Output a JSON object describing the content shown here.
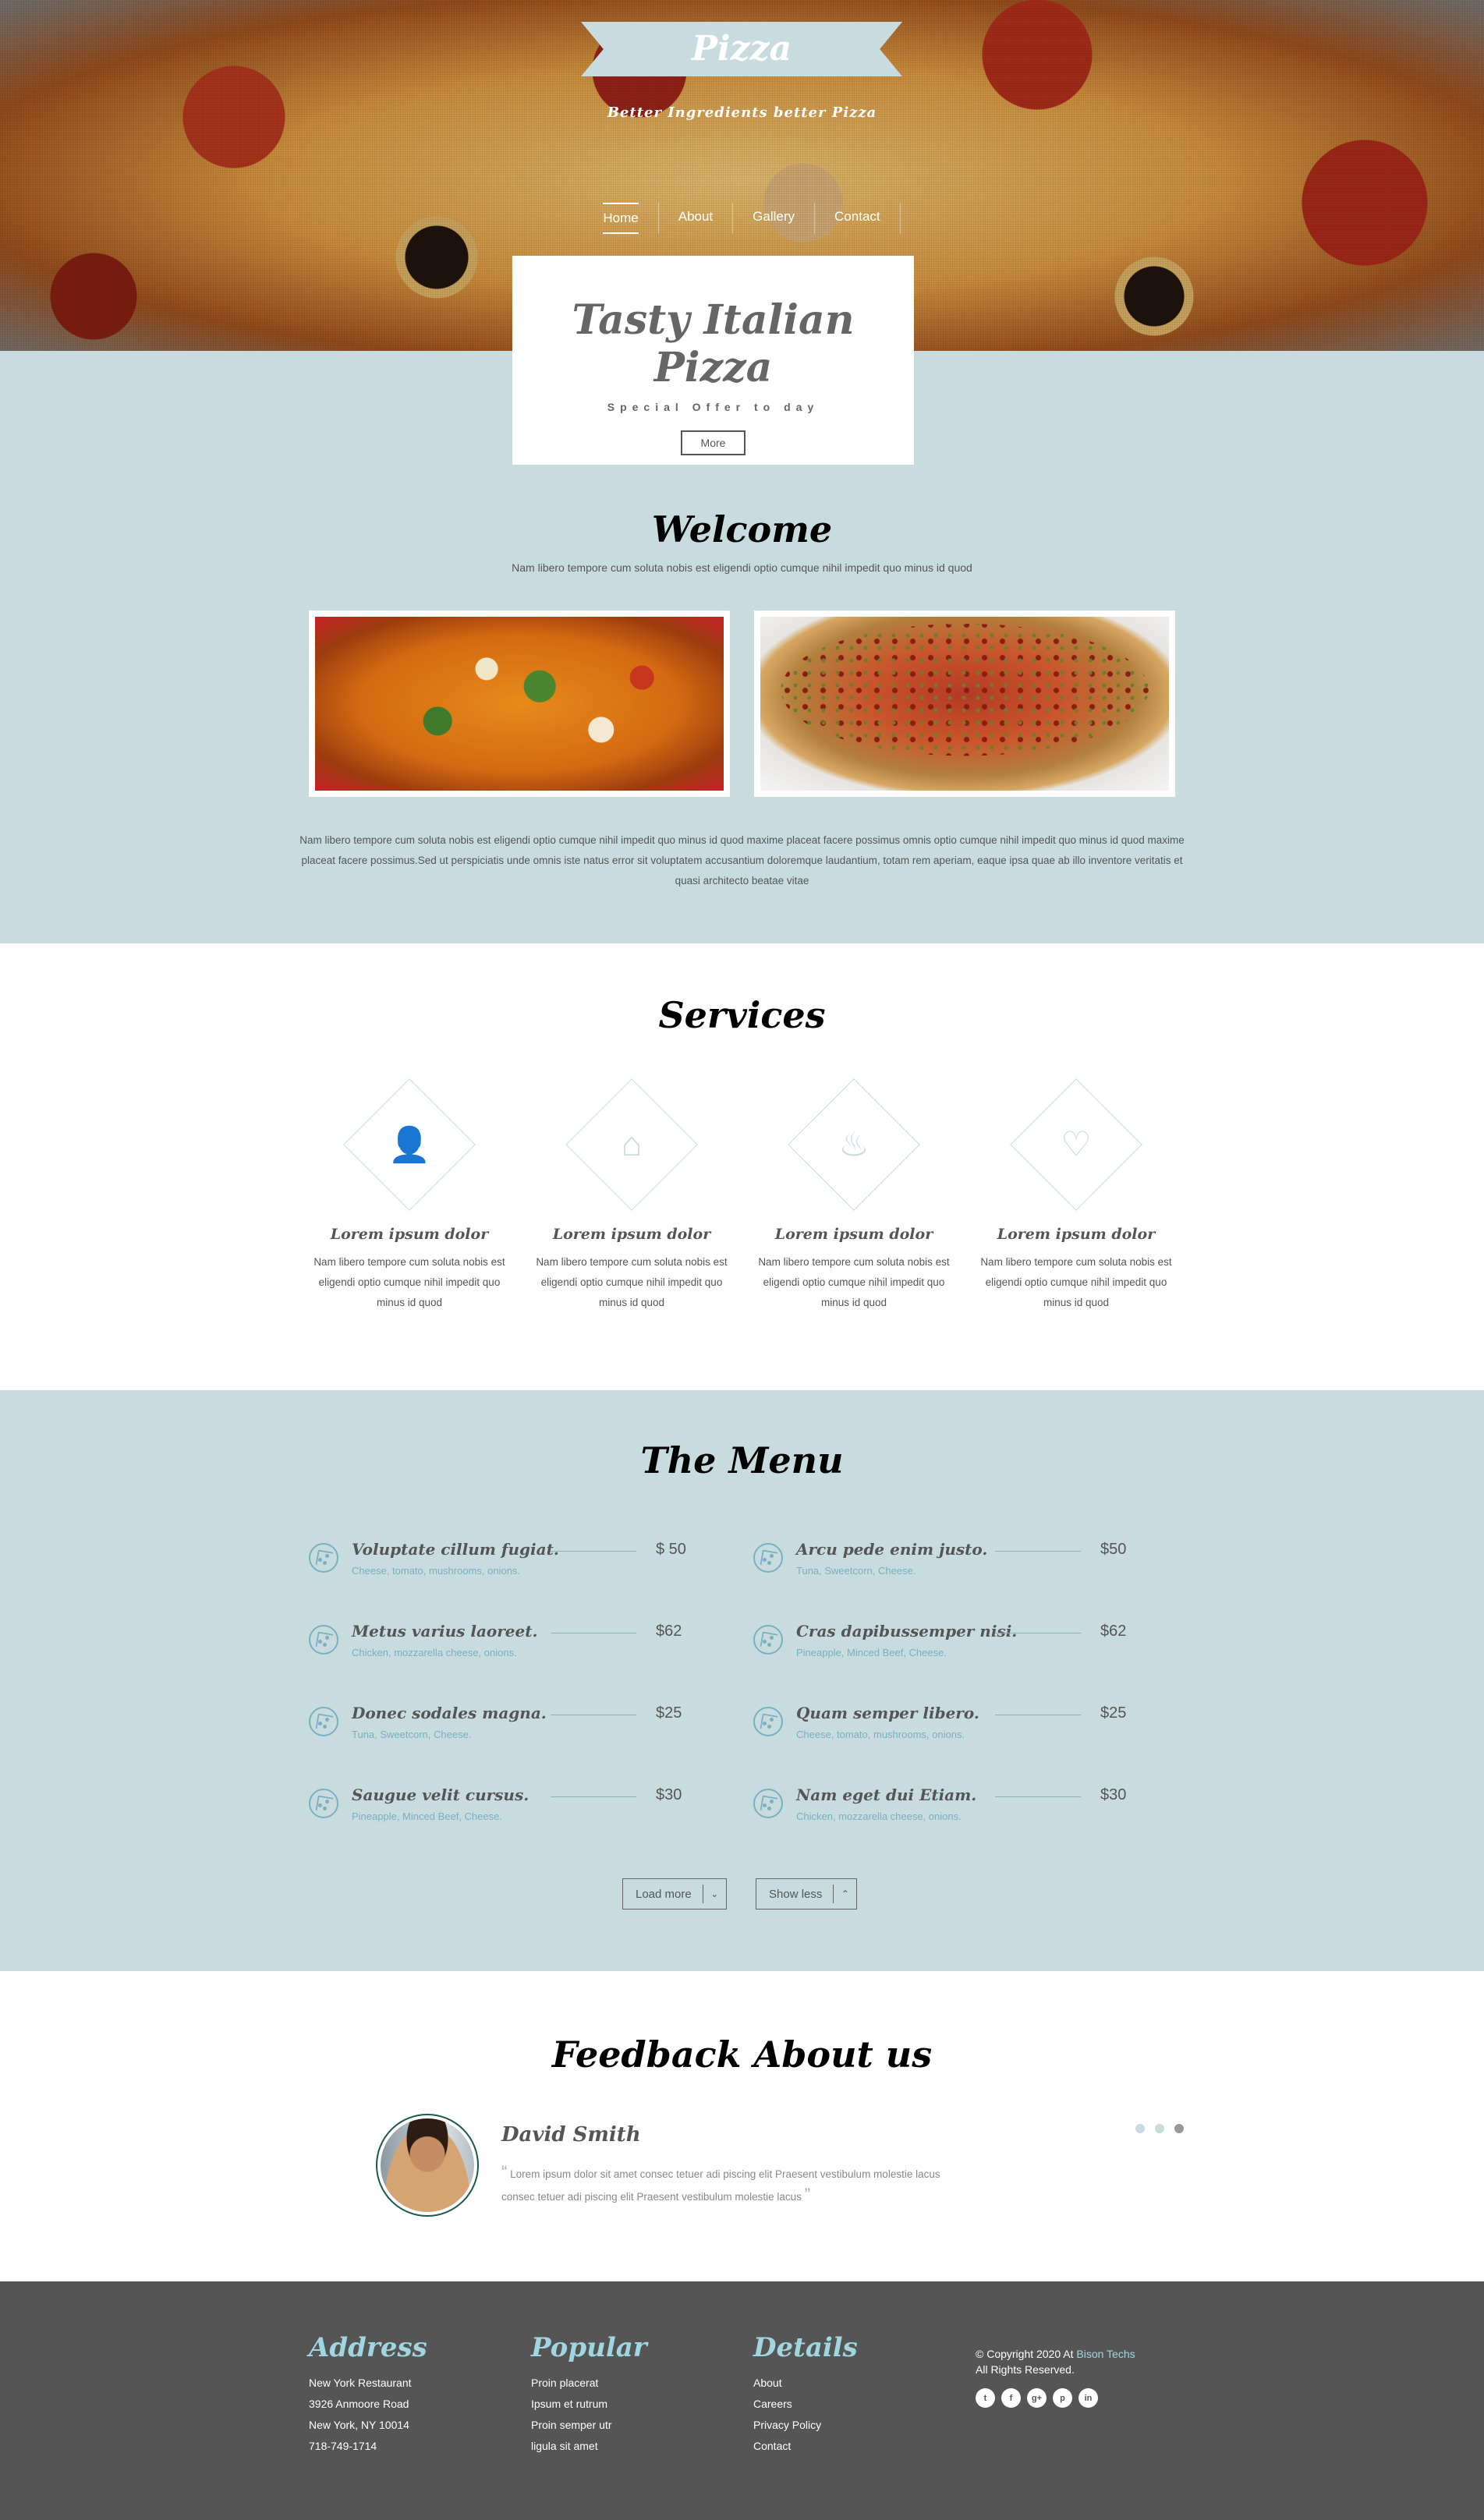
{
  "hero": {
    "brand": "Pizza",
    "tagline": "Better Ingredients better Pizza",
    "nav": [
      "Home",
      "About",
      "Gallery",
      "Contact"
    ],
    "offer": {
      "title": "Tasty Italian Pizza",
      "subtitle": "Special Offer to day",
      "button": "More"
    }
  },
  "welcome": {
    "title": "Welcome",
    "lead": "Nam libero tempore cum soluta nobis est eligendi optio cumque nihil impedit quo minus id quod",
    "paragraph": "Nam libero tempore cum soluta nobis est eligendi optio cumque nihil impedit quo minus id quod maxime placeat facere possimus omnis optio cumque nihil impedit quo minus id quod maxime placeat facere possimus.Sed ut perspiciatis unde omnis iste natus error sit voluptatem accusantium doloremque laudantium, totam rem aperiam, eaque ipsa quae ab illo inventore veritatis et quasi architecto beatae vitae"
  },
  "services": {
    "title": "Services",
    "items": [
      {
        "icon": "user-icon",
        "glyph": "👤",
        "title": "Lorem ipsum dolor",
        "text": "Nam libero tempore cum soluta nobis est eligendi optio cumque nihil impedit quo minus id quod"
      },
      {
        "icon": "home-icon",
        "glyph": "⌂",
        "title": "Lorem ipsum dolor",
        "text": "Nam libero tempore cum soluta nobis est eligendi optio cumque nihil impedit quo minus id quod"
      },
      {
        "icon": "fire-icon",
        "glyph": "♨",
        "title": "Lorem ipsum dolor",
        "text": "Nam libero tempore cum soluta nobis est eligendi optio cumque nihil impedit quo minus id quod"
      },
      {
        "icon": "heart-icon",
        "glyph": "♡",
        "title": "Lorem ipsum dolor",
        "text": "Nam libero tempore cum soluta nobis est eligendi optio cumque nihil impedit quo minus id quod"
      }
    ]
  },
  "menu": {
    "title": "The Menu",
    "left": [
      {
        "name": "Voluptate cillum fugiat.",
        "ingredients": "Cheese, tomato, mushrooms, onions.",
        "price": "$ 50"
      },
      {
        "name": "Metus varius laoreet.",
        "ingredients": "Chicken, mozzarella cheese, onions.",
        "price": "$62"
      },
      {
        "name": "Donec sodales magna.",
        "ingredients": "Tuna, Sweetcorn, Cheese.",
        "price": "$25"
      },
      {
        "name": "Saugue velit cursus.",
        "ingredients": "Pineapple, Minced Beef, Cheese.",
        "price": "$30"
      }
    ],
    "right": [
      {
        "name": "Arcu pede enim justo.",
        "ingredients": "Tuna, Sweetcorn, Cheese.",
        "price": "$50"
      },
      {
        "name": "Cras dapibussemper nisi.",
        "ingredients": "Pineapple, Minced Beef, Cheese.",
        "price": "$62"
      },
      {
        "name": "Quam semper libero.",
        "ingredients": "Cheese, tomato, mushrooms, onions.",
        "price": "$25"
      },
      {
        "name": "Nam eget dui Etiam.",
        "ingredients": "Chicken, mozzarella cheese, onions.",
        "price": "$30"
      }
    ],
    "load_more": "Load more",
    "show_less": "Show less"
  },
  "feedback": {
    "title": "Feedback About us",
    "name": "David Smith",
    "quote": "Lorem ipsum dolor sit amet consec tetuer adi piscing elit Praesent vestibulum molestie lacus consec tetuer adi piscing elit Praesent vestibulum molestie lacus",
    "active_slide": 3,
    "slides": 3
  },
  "footer": {
    "address": {
      "title": "Address",
      "lines": [
        "New York Restaurant",
        "3926 Anmoore Road",
        "New York, NY 10014",
        "718-749-1714"
      ]
    },
    "popular": {
      "title": "Popular",
      "lines": [
        "Proin placerat",
        "Ipsum et rutrum",
        "Proin semper utr",
        "ligula sit amet"
      ]
    },
    "details": {
      "title": "Details",
      "lines": [
        "About",
        "Careers",
        "Privacy Policy",
        "Contact"
      ]
    },
    "copyright_prefix": "© Copyright 2020 At ",
    "copyright_brand": "Bison Techs",
    "rights": "All Rights Reserved.",
    "socials": [
      {
        "icon": "twitter-icon",
        "glyph": "t"
      },
      {
        "icon": "facebook-icon",
        "glyph": "f"
      },
      {
        "icon": "google-plus-icon",
        "glyph": "g+"
      },
      {
        "icon": "pinterest-icon",
        "glyph": "p"
      },
      {
        "icon": "linkedin-icon",
        "glyph": "in"
      }
    ]
  },
  "colors": {
    "accent": "#c8dce0",
    "footer_bg": "#555555",
    "footer_heading": "#9fd6e0",
    "menu_ingredient": "#7ab0bf"
  }
}
